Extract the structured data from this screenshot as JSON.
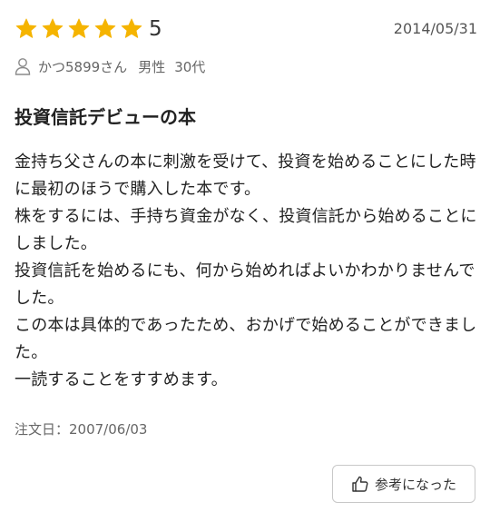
{
  "review": {
    "rating": 5,
    "rating_max": 5,
    "score_label": "5",
    "date": "2014/05/31",
    "reviewer": {
      "name": "かつ5899さん",
      "gender": "男性",
      "age": "30代"
    },
    "title": "投資信託デビューの本",
    "body_lines": [
      "金持ち父さんの本に刺激を受けて、投資を始めることにした時に最初のほうで購入した本です。",
      "株をするには、手持ち資金がなく、投資信託から始めることにしました。",
      "投資信託を始めるにも、何から始めればよいかわかりませんでした。",
      "この本は具体的であったため、おかげで始めることができました。",
      "一読することをすすめます。"
    ],
    "order_date": "注文日：2007/06/03",
    "helpful_label": "参考になった"
  },
  "colors": {
    "star": "#F5B400",
    "text": "#222222",
    "muted": "#666666",
    "button_border": "#C8C8C8"
  },
  "icons": {
    "reviewer": "person-icon",
    "helpful": "thumbs-up-icon",
    "star": "star-icon"
  }
}
